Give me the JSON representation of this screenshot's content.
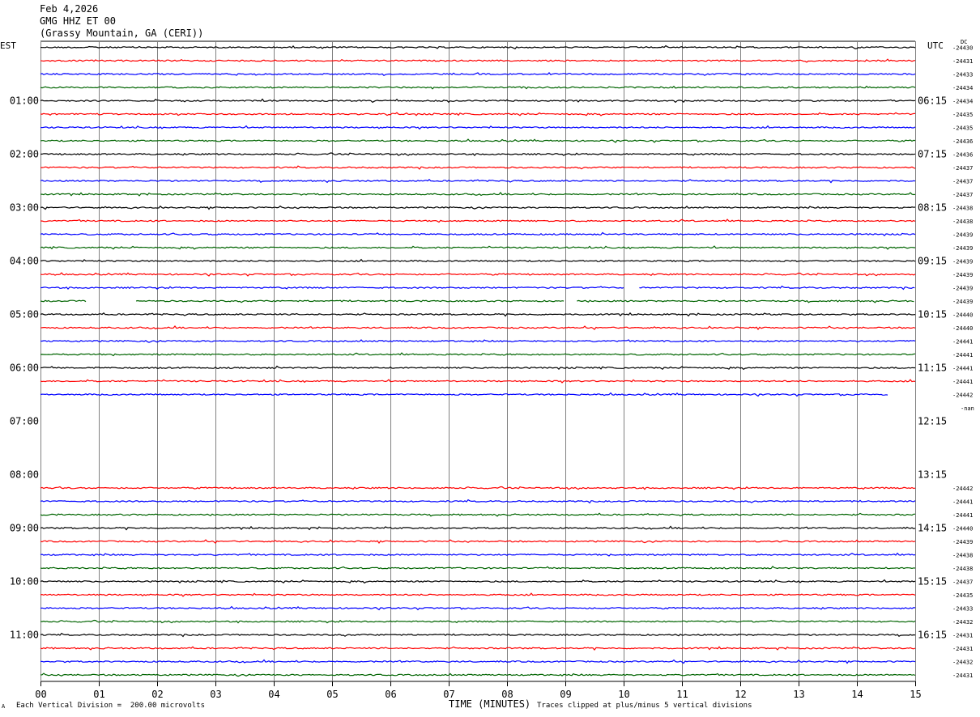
{
  "header": {
    "date": "Feb 4,2026",
    "station": "GMG HHZ ET 00",
    "location": "(Grassy Mountain, GA (CERI))"
  },
  "footer": {
    "scale_note": "Each Vertical Division =  200.00 microvolts",
    "xlabel": "TIME (MINUTES)",
    "clip_note": "Traces clipped at plus/minus 5 vertical divisions",
    "mini_mark": "A"
  },
  "chart_data": {
    "type": "line",
    "title": "GMG HHZ ET 00",
    "xlabel": "TIME (MINUTES)",
    "xlim": [
      0,
      15
    ],
    "x_ticks": [
      "00",
      "01",
      "02",
      "03",
      "04",
      "05",
      "06",
      "07",
      "08",
      "09",
      "10",
      "11",
      "12",
      "13",
      "14",
      "15"
    ],
    "left_axis_title": "EST",
    "right_axis_title": "UTC",
    "dc_label": "DC",
    "left_hour_labels": [
      "01:00",
      "02:00",
      "03:00",
      "04:00",
      "05:00",
      "06:00",
      "07:00",
      "08:00",
      "09:00",
      "10:00",
      "11:00"
    ],
    "right_hour_labels": [
      "06:15",
      "07:15",
      "08:15",
      "09:15",
      "10:15",
      "11:15",
      "12:15",
      "13:15",
      "14:15",
      "15:15",
      "16:15"
    ],
    "colors": {
      "black": "#000000",
      "red": "#ff0000",
      "blue": "#0000ff",
      "green": "#006400",
      "grid": "#808080"
    },
    "color_cycle": [
      "black",
      "red",
      "blue",
      "green"
    ],
    "row_count": 48,
    "traces": [
      {
        "row": 0,
        "dc": "-24430",
        "seg": [
          [
            0,
            15
          ]
        ]
      },
      {
        "row": 1,
        "dc": "-24431",
        "seg": [
          [
            0,
            15
          ]
        ]
      },
      {
        "row": 2,
        "dc": "-24433",
        "seg": [
          [
            0,
            15
          ]
        ]
      },
      {
        "row": 3,
        "dc": "-24434",
        "seg": [
          [
            0,
            15
          ]
        ]
      },
      {
        "row": 4,
        "dc": "-24434",
        "seg": [
          [
            0,
            15
          ]
        ]
      },
      {
        "row": 5,
        "dc": "-24435",
        "seg": [
          [
            0,
            15
          ]
        ]
      },
      {
        "row": 6,
        "dc": "-24435",
        "seg": [
          [
            0,
            15
          ]
        ]
      },
      {
        "row": 7,
        "dc": "-24436",
        "seg": [
          [
            0,
            15
          ]
        ]
      },
      {
        "row": 8,
        "dc": "-24436",
        "seg": [
          [
            0,
            15
          ]
        ]
      },
      {
        "row": 9,
        "dc": "-24437",
        "seg": [
          [
            0,
            15
          ]
        ]
      },
      {
        "row": 10,
        "dc": "-24437",
        "seg": [
          [
            0,
            15
          ]
        ]
      },
      {
        "row": 11,
        "dc": "-24437",
        "seg": [
          [
            0,
            15
          ]
        ]
      },
      {
        "row": 12,
        "dc": "-24438",
        "seg": [
          [
            0,
            15
          ]
        ]
      },
      {
        "row": 13,
        "dc": "-24438",
        "seg": [
          [
            0,
            15
          ]
        ]
      },
      {
        "row": 14,
        "dc": "-24439",
        "seg": [
          [
            0,
            15
          ]
        ]
      },
      {
        "row": 15,
        "dc": "-24439",
        "seg": [
          [
            0,
            15
          ]
        ]
      },
      {
        "row": 16,
        "dc": "-24439",
        "seg": [
          [
            0,
            15
          ]
        ]
      },
      {
        "row": 17,
        "dc": "-24439",
        "seg": [
          [
            0,
            15
          ]
        ]
      },
      {
        "row": 18,
        "dc": "-24439",
        "seg": [
          [
            0,
            10.0
          ],
          [
            10.27,
            15
          ]
        ]
      },
      {
        "row": 19,
        "dc": "-24439",
        "seg": [
          [
            0,
            0.78
          ],
          [
            1.64,
            9.0
          ],
          [
            9.2,
            15
          ]
        ]
      },
      {
        "row": 20,
        "dc": "-24440",
        "seg": [
          [
            0,
            15
          ]
        ]
      },
      {
        "row": 21,
        "dc": "-24440",
        "seg": [
          [
            0,
            15
          ]
        ]
      },
      {
        "row": 22,
        "dc": "-24441",
        "seg": [
          [
            0,
            15
          ]
        ]
      },
      {
        "row": 23,
        "dc": "-24441",
        "seg": [
          [
            0,
            15
          ]
        ]
      },
      {
        "row": 24,
        "dc": "-24441",
        "seg": [
          [
            0,
            15
          ]
        ]
      },
      {
        "row": 25,
        "dc": "-24441",
        "seg": [
          [
            0,
            15
          ]
        ]
      },
      {
        "row": 26,
        "dc": "-24442",
        "seg": [
          [
            0,
            14.55
          ]
        ]
      },
      {
        "row": 33,
        "dc": "-24442",
        "seg": [
          [
            0,
            15
          ]
        ]
      },
      {
        "row": 34,
        "dc": "-24441",
        "seg": [
          [
            0,
            15
          ]
        ]
      },
      {
        "row": 35,
        "dc": "-24441",
        "seg": [
          [
            0,
            15
          ]
        ]
      },
      {
        "row": 36,
        "dc": "-24440",
        "seg": [
          [
            0,
            15
          ]
        ]
      },
      {
        "row": 37,
        "dc": "-24439",
        "seg": [
          [
            0,
            15
          ]
        ]
      },
      {
        "row": 38,
        "dc": "-24438",
        "seg": [
          [
            0,
            15
          ]
        ]
      },
      {
        "row": 39,
        "dc": "-24438",
        "seg": [
          [
            0,
            15
          ]
        ]
      },
      {
        "row": 40,
        "dc": "-24437",
        "seg": [
          [
            0,
            15
          ]
        ]
      },
      {
        "row": 41,
        "dc": "-24435",
        "seg": [
          [
            0,
            15
          ]
        ]
      },
      {
        "row": 42,
        "dc": "-24433",
        "seg": [
          [
            0,
            15
          ]
        ]
      },
      {
        "row": 43,
        "dc": "-24432",
        "seg": [
          [
            0,
            15
          ]
        ]
      },
      {
        "row": 44,
        "dc": "-24431",
        "seg": [
          [
            0,
            15
          ]
        ]
      },
      {
        "row": 45,
        "dc": "-24431",
        "seg": [
          [
            0,
            15
          ]
        ]
      },
      {
        "row": 46,
        "dc": "-24432",
        "seg": [
          [
            0,
            15
          ]
        ]
      },
      {
        "row": 47,
        "dc": "-24431",
        "seg": [
          [
            0,
            15
          ]
        ]
      }
    ],
    "dc_notes": [
      {
        "row": 27,
        "text": "-nan"
      }
    ]
  }
}
